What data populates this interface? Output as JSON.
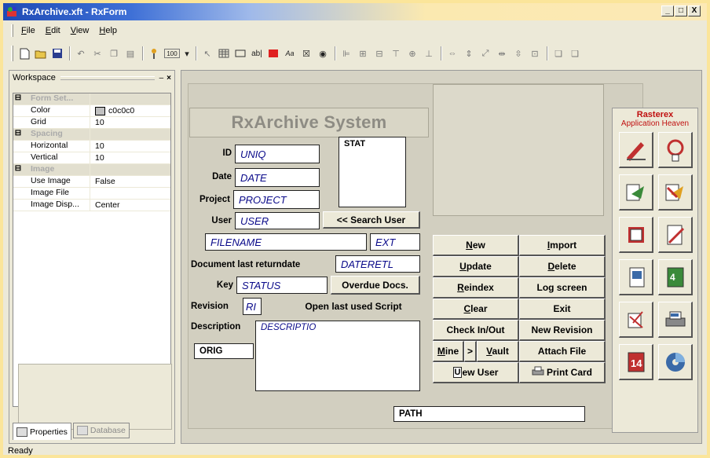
{
  "window": {
    "title": "RxArchive.xft - RxForm",
    "min_label": "_",
    "max_label": "□",
    "close_label": "X"
  },
  "menu": [
    {
      "label": "File"
    },
    {
      "label": "Edit"
    },
    {
      "label": "View"
    },
    {
      "label": "Help"
    }
  ],
  "toolbar": {
    "icons": [
      "new-icon",
      "open-icon",
      "save-icon",
      "undo-icon",
      "cut-icon",
      "copy-icon",
      "paste-icon",
      "wizard-icon",
      "zoom-icon",
      "pointer-icon",
      "grid-icon",
      "rectangle-icon",
      "textbox-icon",
      "color-icon",
      "font-icon",
      "checkbox-icon",
      "radio-icon",
      "align-left-icon",
      "align-center-icon",
      "align-right-icon",
      "align-top-icon",
      "align-middle-icon",
      "align-bottom-icon",
      "same-width-icon",
      "same-height-icon",
      "same-size-icon",
      "space-horizontal-icon",
      "space-vertical-icon",
      "center-icon",
      "bring-front-icon",
      "send-back-icon"
    ],
    "zoom_label": "100"
  },
  "workspace": {
    "title": "Workspace",
    "pin": "–",
    "close": "×",
    "properties": [
      {
        "type": "category",
        "name": "Form Set..."
      },
      {
        "type": "prop",
        "name": "Color",
        "value": "c0c0c0",
        "swatch": "#c0c0c0"
      },
      {
        "type": "prop",
        "name": "Grid",
        "value": "10"
      },
      {
        "type": "category",
        "name": "Spacing"
      },
      {
        "type": "prop",
        "name": "Horizontal",
        "value": "10"
      },
      {
        "type": "prop",
        "name": "Vertical",
        "value": "10"
      },
      {
        "type": "category",
        "name": "Image"
      },
      {
        "type": "prop",
        "name": "Use Image",
        "value": "False"
      },
      {
        "type": "prop",
        "name": "Image File",
        "value": ""
      },
      {
        "type": "prop",
        "name": "Image Disp...",
        "value": "Center"
      }
    ],
    "tabs": [
      {
        "label": "Properties",
        "active": true
      },
      {
        "label": "Database",
        "active": false
      }
    ]
  },
  "form": {
    "title": "RxArchive System",
    "labels": {
      "id": "ID",
      "date": "Date",
      "project": "Project",
      "user": "User",
      "doc_returndate": "Document last returndate",
      "key": "Key",
      "revision": "Revision",
      "description": "Description"
    },
    "fields": {
      "id": "UNIQ",
      "stat": "STAT",
      "date": "DATE",
      "project": "PROJECT",
      "user": "USER",
      "filename": "FILENAME",
      "ext": "EXT",
      "dateretl": "DATERETL",
      "status": "STATUS",
      "revision": "RI",
      "description": "DESCRIPTIO",
      "orig": "ORIG",
      "path": "PATH"
    },
    "buttons": {
      "search_user": "<< Search User",
      "overdue_docs": "Overdue Docs.",
      "open_last_script": "Open last used Script",
      "new": "New",
      "import": "Import",
      "update": "Update",
      "delete": "Delete",
      "reindex": "Reindex",
      "log_screen": "Log screen",
      "clear": "Clear",
      "exit": "Exit",
      "check_in_out": "Check In/Out",
      "new_revision": "New Revision",
      "mine": "Mine",
      "arrow": ">",
      "vault": "Vault",
      "attach_file": "Attach File",
      "new_user_u": "U",
      "new_user": "ew User",
      "print_card": "Print Card"
    }
  },
  "rasterex": {
    "brand": "Rasterex",
    "tagline": "Application Heaven",
    "buttons": [
      "markup-icon",
      "search-doc-icon",
      "convert-icon",
      "color-convert-icon",
      "print-stack-icon",
      "edit-doc-icon",
      "document-icon",
      "viewer-icon",
      "compare-icon",
      "printer-icon",
      "calendar-icon",
      "disk-icon"
    ]
  },
  "status": {
    "text": "Ready"
  }
}
